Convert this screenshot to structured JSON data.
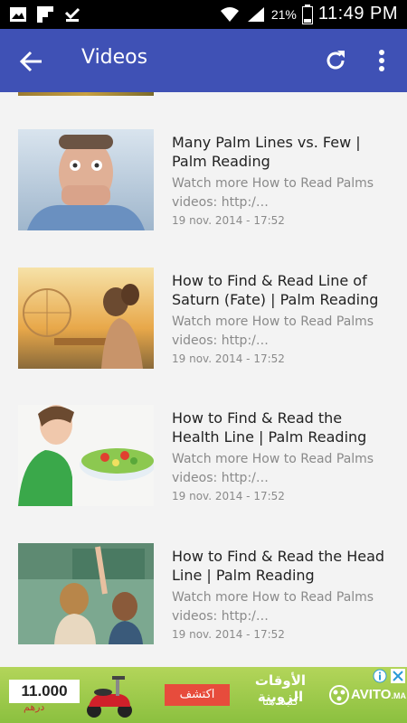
{
  "status_bar": {
    "battery_percent": "21%",
    "time": "11:49 PM",
    "icons": [
      "gallery-icon",
      "flipboard-icon",
      "download-done-icon",
      "wifi-icon",
      "signal-icon",
      "battery-icon"
    ]
  },
  "app_bar": {
    "title": "Videos",
    "background": "#3f51b5",
    "icons": [
      "back-arrow-icon",
      "refresh-icon",
      "more-vert-icon"
    ]
  },
  "videos": [
    {
      "title": "Many Palm Lines vs. Few | Palm Reading",
      "description": "Watch more How to Read Palms videos: http:/…",
      "date": "19 nov. 2014 - 17:52"
    },
    {
      "title": "How to Find & Read Line of Saturn (Fate) | Palm Reading",
      "description": "Watch more How to Read Palms videos: http:/…",
      "date": "19 nov. 2014 - 17:52"
    },
    {
      "title": "How to Find & Read the Health Line | Palm Reading",
      "description": "Watch more How to Read Palms videos: http:/…",
      "date": "19 nov. 2014 - 17:52"
    },
    {
      "title": "How to Find & Read the Head Line | Palm Reading",
      "description": "Watch more How to Read Palms videos: http:/…",
      "date": "19 nov. 2014 - 17:52"
    }
  ],
  "ad": {
    "price": "11.000",
    "currency": "درهم",
    "cta": "اكتشف",
    "headline": "الأوقات الزوينة",
    "subline": "كتبدا هنا",
    "brand": "AVITO",
    "brand_suffix": ".MA",
    "background": "#9cc84a"
  }
}
